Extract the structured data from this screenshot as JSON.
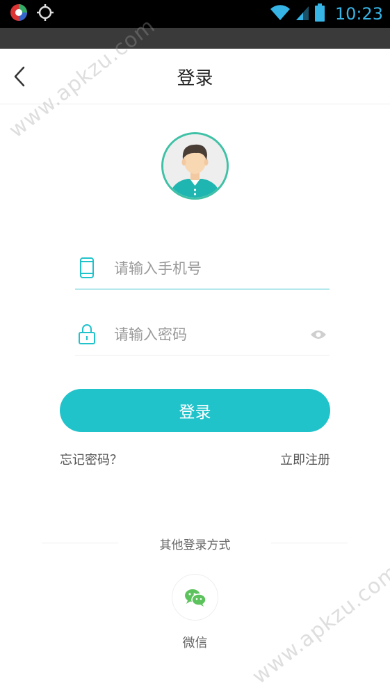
{
  "status_bar": {
    "time": "10:23"
  },
  "header": {
    "title": "登录",
    "back_icon": "chevron-left-icon"
  },
  "login_form": {
    "phone_placeholder": "请输入手机号",
    "password_placeholder": "请输入密码",
    "submit_label": "登录",
    "forgot_label": "忘记密码？",
    "register_label": "立即注册"
  },
  "other_login": {
    "title": "其他登录方式",
    "wechat_label": "微信"
  },
  "watermark": {
    "text": "www.apkzu.com"
  },
  "colors": {
    "accent": "#21c3cb",
    "avatar_ring": "#3fc1a6",
    "wechat": "#5cc25c",
    "status_time": "#37b4e6"
  }
}
